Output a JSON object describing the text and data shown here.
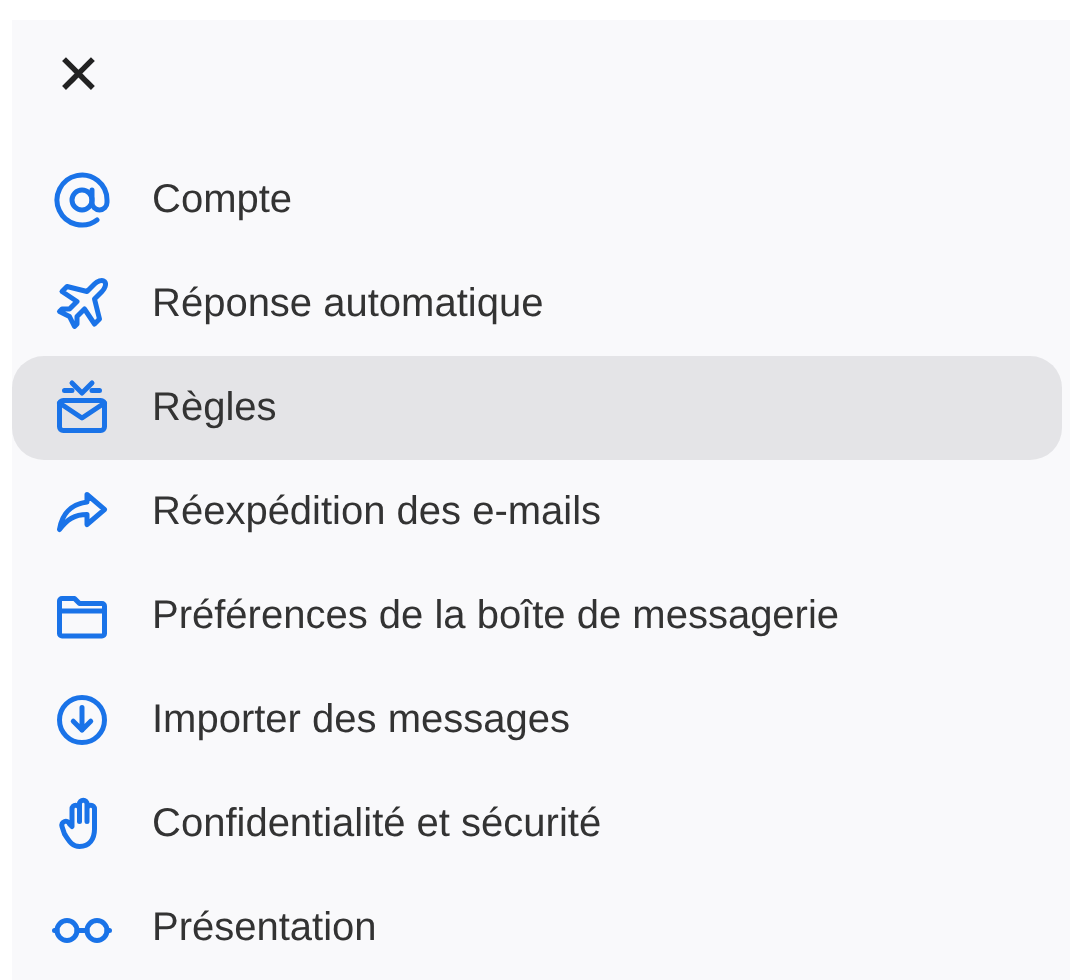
{
  "close_button": {
    "label": "✕"
  },
  "menu": [
    {
      "label": "Compte",
      "selected": false
    },
    {
      "label": "Réponse automatique",
      "selected": false
    },
    {
      "label": "Règles",
      "selected": true
    },
    {
      "label": "Réexpédition des e-mails",
      "selected": false
    },
    {
      "label": "Préférences de la boîte de messagerie",
      "selected": false
    },
    {
      "label": "Importer des messages",
      "selected": false
    },
    {
      "label": "Confidentialité et sécurité",
      "selected": false
    },
    {
      "label": "Présentation",
      "selected": false
    }
  ]
}
